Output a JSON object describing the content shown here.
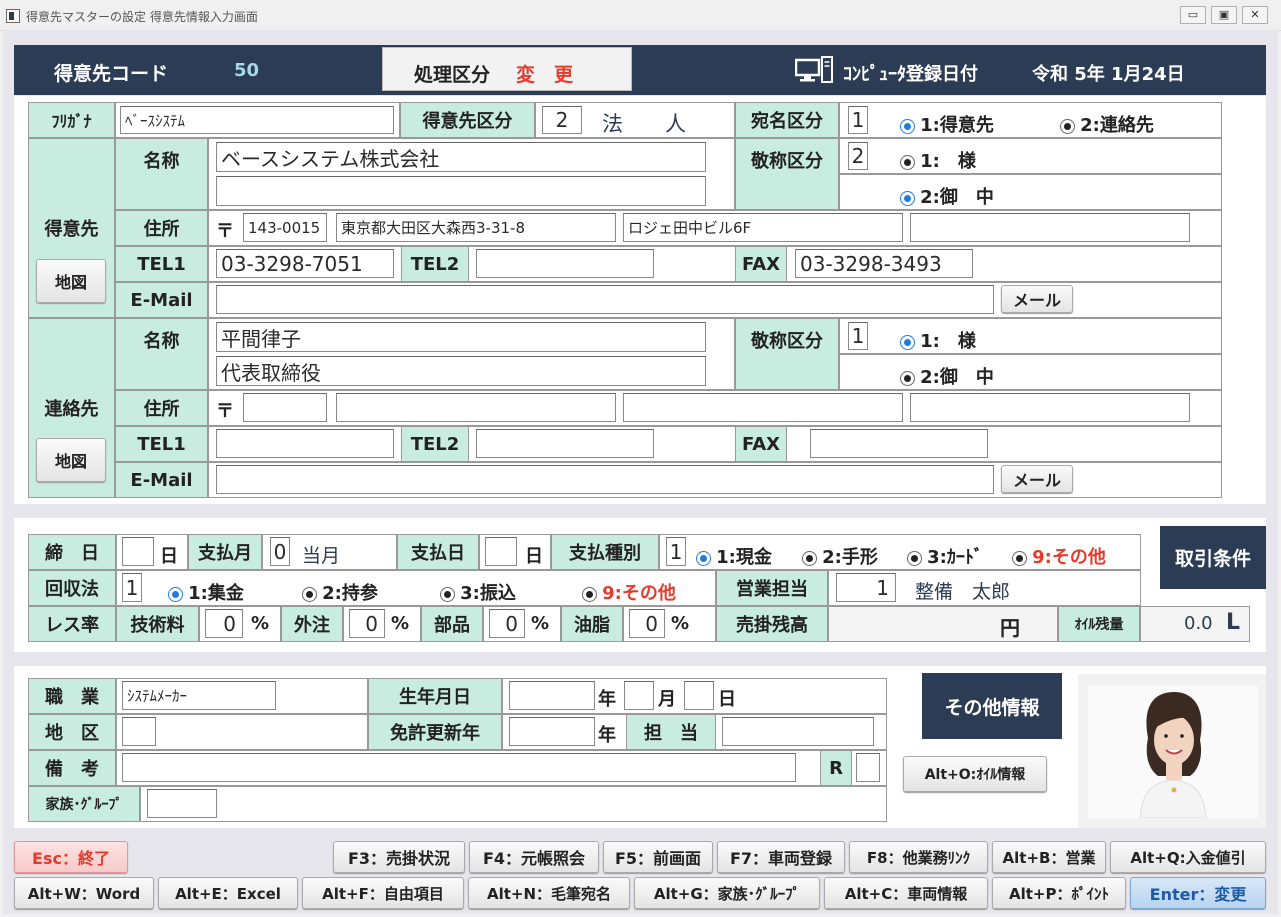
{
  "window": {
    "title": "得意先マスターの設定 得意先情報入力画面",
    "buttons": [
      "▭",
      "▣",
      "✕"
    ]
  },
  "header": {
    "code_label": "得意先コード",
    "code_value": "50",
    "proc_label": "処理区分",
    "proc_value": "変　更",
    "reg_label": "ｺﾝﾋﾟｭｰﾀ登録日付",
    "reg_date": "令和 5年 1月24日"
  },
  "customer": {
    "furigana_label": "ﾌﾘｶﾞﾅ",
    "furigana_value": "ﾍﾞｰｽｼｽﾃﾑ",
    "kubun_label": "得意先区分",
    "kubun_value": "2",
    "kubun_text": "法　　人",
    "atena_label": "宛名区分",
    "atena_value": "1",
    "atena_opt1": "1:得意先",
    "atena_opt2": "2:連絡先",
    "section_label": "得意先",
    "map_button": "地図",
    "name_label": "名称",
    "name1": "ベースシステム株式会社",
    "name2": "",
    "keisho_label": "敬称区分",
    "keisho_value": "2",
    "keisho_opt1": "1:　様",
    "keisho_opt2": "2:御　中",
    "addr_label": "住所",
    "postal_mark": "〒",
    "postal": "143-0015",
    "addr1": "東京都大田区大森西3-31-8",
    "addr2": "ロジェ田中ビル6F",
    "addr3": "",
    "tel1_label": "TEL1",
    "tel1": "03-3298-7051",
    "tel2_label": "TEL2",
    "tel2": "",
    "fax_label": "FAX",
    "fax": "03-3298-3493",
    "email_label": "E-Mail",
    "email": "",
    "mail_button": "メール"
  },
  "contact": {
    "section_label": "連絡先",
    "map_button": "地図",
    "name_label": "名称",
    "name1": "平間律子",
    "name2": "代表取締役",
    "keisho_label": "敬称区分",
    "keisho_value": "1",
    "keisho_opt1": "1:　様",
    "keisho_opt2": "2:御　中",
    "addr_label": "住所",
    "postal_mark": "〒",
    "postal": "",
    "addr1": "",
    "addr2": "",
    "addr3": "",
    "tel1_label": "TEL1",
    "tel1": "",
    "tel2_label": "TEL2",
    "tel2": "",
    "fax_label": "FAX",
    "fax": "",
    "email_label": "E-Mail",
    "email": "",
    "mail_button": "メール"
  },
  "terms": {
    "shime_label": "締　日",
    "shime_value": "",
    "day_unit": "日",
    "shiharai_tsuki_label": "支払月",
    "shiharai_tsuki_value": "0",
    "shiharai_tsuki_text": "当月",
    "shiharai_bi_label": "支払日",
    "shiharai_bi_value": "",
    "shubetsu_label": "支払種別",
    "shubetsu_value": "1",
    "shubetsu_opt1": "1:現金",
    "shubetsu_opt2": "2:手形",
    "shubetsu_opt3": "3:ｶｰﾄﾞ",
    "shubetsu_opt9": "9:その他",
    "conditions_button": "取引条件",
    "kaishu_label": "回収法",
    "kaishu_value": "1",
    "kaishu_opt1": "1:集金",
    "kaishu_opt2": "2:持参",
    "kaishu_opt3": "3:振込",
    "kaishu_opt9": "9:その他",
    "eigyo_label": "営業担当",
    "eigyo_value": "1",
    "eigyo_name": "整備　太郎",
    "less_label": "レス率",
    "gijutsu_label": "技術料",
    "gijutsu_value": "0",
    "gaichu_label": "外注",
    "gaichu_value": "0",
    "buhin_label": "部品",
    "buhin_value": "0",
    "yushi_label": "油脂",
    "yushi_value": "0",
    "pct": "%",
    "urikake_label": "売掛残高",
    "urikake_unit": "円",
    "oil_label": "ｵｲﾙ残量",
    "oil_value": "0.0",
    "oil_unit": "L"
  },
  "other": {
    "shokugyo_label": "職　業",
    "shokugyo_value": "ｼｽﾃﾑﾒｰｶｰ",
    "birth_label": "生年月日",
    "year_unit": "年",
    "month_unit": "月",
    "day_unit": "日",
    "chiku_label": "地　区",
    "license_label": "免許更新年",
    "tanto_label": "担　当",
    "biko_label": "備　考",
    "r_label": "R",
    "family_label": "家族･ｸﾞﾙｰﾌﾟ",
    "info_button": "その他情報",
    "oil_button": "Alt+O:ｵｲﾙ情報"
  },
  "fkeys": {
    "row1": [
      {
        "label": "Esc：終了"
      },
      {
        "label": "F3：売掛状況"
      },
      {
        "label": "F4：元帳照会"
      },
      {
        "label": "F5：前画面"
      },
      {
        "label": "F7：車両登録"
      },
      {
        "label": "F8：他業務ﾘﾝｸ"
      },
      {
        "label": "Alt+B：営業"
      },
      {
        "label": "Alt+Q:入金値引"
      }
    ],
    "row2": [
      {
        "label": "Alt+W：Word"
      },
      {
        "label": "Alt+E：Excel"
      },
      {
        "label": "Alt+F：自由項目"
      },
      {
        "label": "Alt+N：毛筆宛名"
      },
      {
        "label": "Alt+G：家族･ｸﾞﾙｰﾌﾟ"
      },
      {
        "label": "Alt+C：車両情報"
      },
      {
        "label": "Alt+P：ﾎﾟｲﾝﾄ"
      },
      {
        "label": "Enter：変更"
      }
    ]
  },
  "colors": {
    "navy": "#2b3c54",
    "teal": "#c8ecdf",
    "red": "#e53b2c",
    "radio_blue": "#1e7be0"
  },
  "icons": [
    "computer-icon",
    "radio-selected-icon",
    "radio-unselected-icon",
    "app-icon",
    "photo-portrait"
  ]
}
